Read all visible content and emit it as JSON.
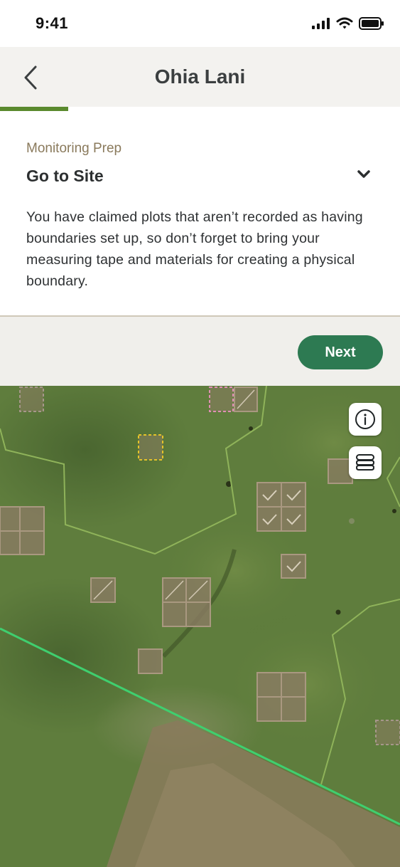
{
  "status_bar": {
    "time": "9:41"
  },
  "header": {
    "title": "Ohia Lani"
  },
  "progress": {
    "fraction": 0.17
  },
  "content": {
    "eyebrow": "Monitoring Prep",
    "section_title": "Go to Site",
    "body": "You have claimed plots that aren’t recorded as having boundaries set up, so don’t forget to bring your measuring tape and materials for creating a physical boundary."
  },
  "footer": {
    "next_label": "Next"
  },
  "map_controls": {
    "info_icon": "info-icon",
    "layers_icon": "layers-icon"
  },
  "colors": {
    "accent_green": "#2d7a52",
    "progress_green": "#5a8a2e",
    "boundary_line": "#3fcf6f"
  }
}
